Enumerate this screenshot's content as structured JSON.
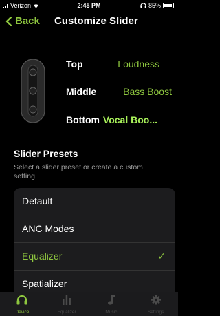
{
  "status_bar": {
    "carrier": "Verizon",
    "time": "2:45 PM",
    "battery": "85%"
  },
  "nav": {
    "back_label": "Back",
    "title": "Customize Slider"
  },
  "slider": {
    "rows": [
      {
        "label": "Top",
        "value": "Loudness"
      },
      {
        "label": "Middle",
        "value": "Bass Boost"
      },
      {
        "label": "Bottom",
        "value": "Vocal Boo..."
      }
    ]
  },
  "presets": {
    "title": "Slider Presets",
    "description": "Select a slider preset or create a custom setting.",
    "items": [
      {
        "label": "Default",
        "selected": false
      },
      {
        "label": "ANC Modes",
        "selected": false
      },
      {
        "label": "Equalizer",
        "selected": true
      },
      {
        "label": "Spatializer",
        "selected": false
      }
    ],
    "check": "✓"
  },
  "tabs": [
    {
      "label": "Device",
      "icon": "headphones-icon",
      "active": true
    },
    {
      "label": "Equalizer",
      "icon": "equalizer-icon",
      "active": false
    },
    {
      "label": "Music",
      "icon": "music-note-icon",
      "active": false
    },
    {
      "label": "Settings",
      "icon": "gear-icon",
      "active": false
    }
  ],
  "colors": {
    "accent": "#8ec63f",
    "background": "#000000",
    "list_bg": "#1c1c1e"
  }
}
